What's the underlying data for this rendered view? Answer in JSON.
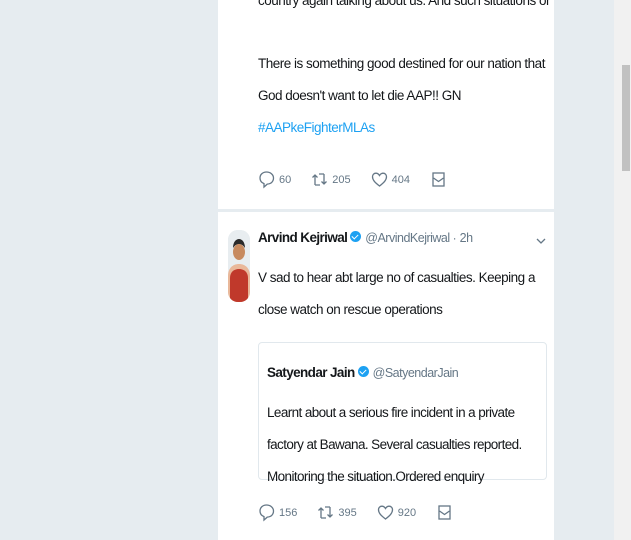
{
  "tweets": [
    {
      "truncated_line": "country again talking about us. And such situations only strengthen us.....",
      "body": "There is something good destined for our nation that God doesn't want to let die AAP!! GN",
      "hashtag": "#AAPkeFighterMLAs",
      "actions": {
        "replies": "60",
        "retweets": "205",
        "likes": "404"
      }
    },
    {
      "author_name": "Arvind Kejriwal",
      "handle": "@ArvindKejriwal",
      "separator": "·",
      "time": "2h",
      "body": "V sad to hear abt large no of casualties. Keeping a close watch on rescue operations",
      "quoted": {
        "author_name": "Satyendar Jain",
        "handle": "@SatyendarJain",
        "body": "Learnt about a serious fire  incident in a private factory at Bawana. Several casualties reported. Monitoring the situation.Ordered enquiry"
      },
      "actions": {
        "replies": "156",
        "retweets": "395",
        "likes": "920"
      }
    }
  ],
  "colors": {
    "link": "#1da1f2",
    "muted": "#657786",
    "background": "#e6ecf0"
  },
  "icons": [
    "reply-icon",
    "retweet-icon",
    "like-icon",
    "message-icon",
    "verified-badge-icon",
    "chevron-down-icon"
  ]
}
